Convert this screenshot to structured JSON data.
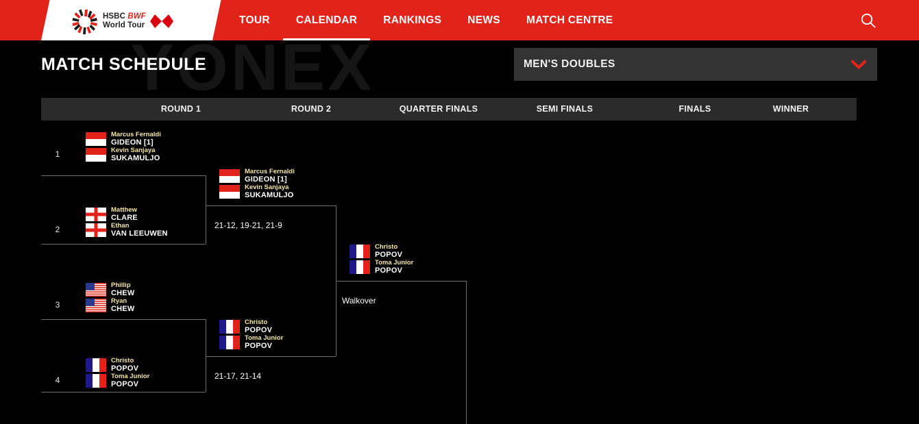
{
  "header": {
    "logo": {
      "brand_line1": "HSBC",
      "brand_bwf": "BWF",
      "brand_line2": "World Tour"
    },
    "nav": [
      {
        "label": "TOUR",
        "active": false
      },
      {
        "label": "CALENDAR",
        "active": true
      },
      {
        "label": "RANKINGS",
        "active": false
      },
      {
        "label": "NEWS",
        "active": false
      },
      {
        "label": "MATCH CENTRE",
        "active": false
      }
    ],
    "search_icon": "search-icon",
    "accent_color": "#e2231a"
  },
  "watermark": "YONEX",
  "page": {
    "title": "MATCH SCHEDULE",
    "category_selected": "MEN'S DOUBLES",
    "chevron_icon": "chevron-down-icon",
    "chevron_color": "#e2231a"
  },
  "columns": [
    {
      "label": "ROUND 1"
    },
    {
      "label": "ROUND 2"
    },
    {
      "label": "QUARTER FINALS"
    },
    {
      "label": "SEMI FINALS"
    },
    {
      "label": "FINALS"
    },
    {
      "label": "WINNER"
    }
  ],
  "bracket": {
    "round1": [
      {
        "number": "1",
        "players": [
          {
            "first": "Marcus Fernaldi",
            "last": "GIDEON [1]",
            "flag": "indonesia"
          },
          {
            "first": "Kevin Sanjaya",
            "last": "SUKAMULJO",
            "flag": "indonesia"
          }
        ]
      },
      {
        "number": "2",
        "players": [
          {
            "first": "Matthew",
            "last": "CLARE",
            "flag": "england"
          },
          {
            "first": "Ethan",
            "last": "VAN LEEUWEN",
            "flag": "england"
          }
        ]
      },
      {
        "number": "3",
        "players": [
          {
            "first": "Phillip",
            "last": "CHEW",
            "flag": "usa"
          },
          {
            "first": "Ryan",
            "last": "CHEW",
            "flag": "usa"
          }
        ]
      },
      {
        "number": "4",
        "players": [
          {
            "first": "Christo",
            "last": "POPOV",
            "flag": "france"
          },
          {
            "first": "Toma Junior",
            "last": "POPOV",
            "flag": "france"
          }
        ]
      }
    ],
    "round2": [
      {
        "players": [
          {
            "first": "Marcus Fernaldi",
            "last": "GIDEON [1]",
            "flag": "indonesia"
          },
          {
            "first": "Kevin Sanjaya",
            "last": "SUKAMULJO",
            "flag": "indonesia"
          }
        ],
        "score": "21-12, 19-21, 21-9"
      },
      {
        "players": [
          {
            "first": "Christo",
            "last": "POPOV",
            "flag": "france"
          },
          {
            "first": "Toma Junior",
            "last": "POPOV",
            "flag": "france"
          }
        ],
        "score": "21-17, 21-14"
      }
    ],
    "quarter_finals": [
      {
        "players": [
          {
            "first": "Christo",
            "last": "POPOV",
            "flag": "france"
          },
          {
            "first": "Toma Junior",
            "last": "POPOV",
            "flag": "france"
          }
        ],
        "score": "Walkover"
      }
    ],
    "semi_finals": [],
    "finals": [],
    "winner": []
  }
}
